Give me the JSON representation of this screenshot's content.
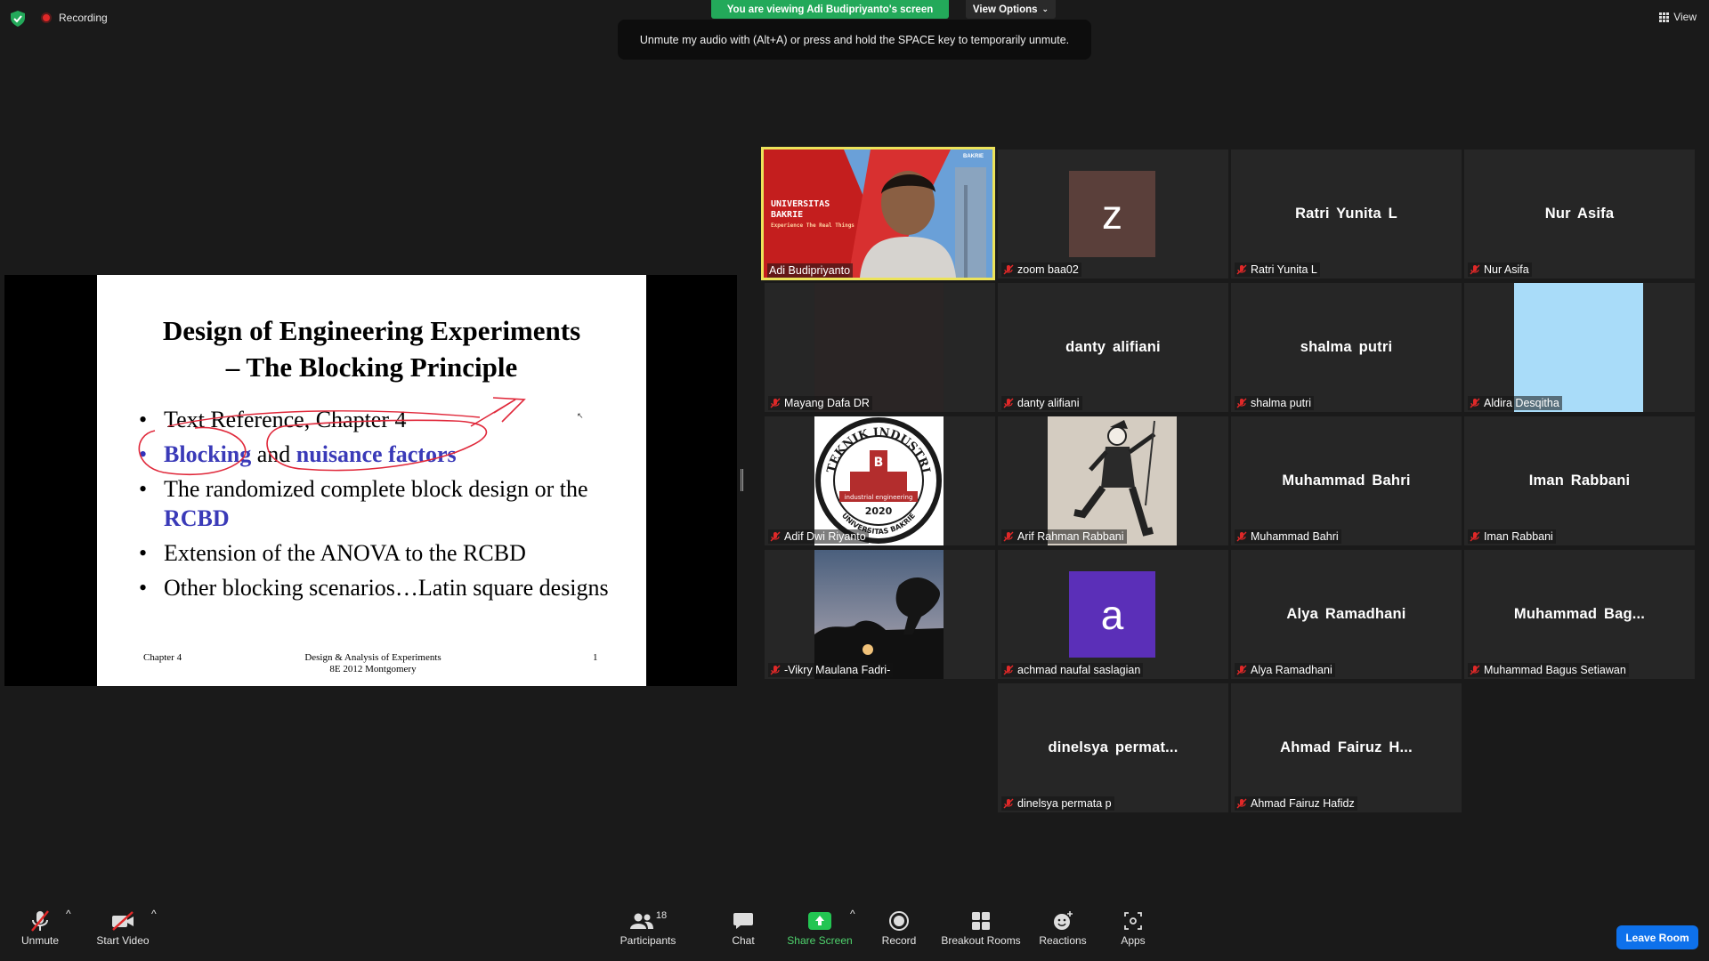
{
  "top": {
    "recording": "Recording",
    "viewing_banner": "You are viewing Adi Budipriyanto's screen",
    "view_options": "View Options",
    "tooltip": "Unmute my audio with (Alt+A) or press and hold the SPACE key to temporarily unmute.",
    "view": "View"
  },
  "slide": {
    "title_line1": "Design of Engineering Experiments",
    "title_line2": "– The Blocking Principle",
    "bullets": [
      {
        "text": "Text Reference, Chapter 4"
      },
      {
        "pre": "Blocking",
        "mid": " and ",
        "post": "nuisance factors"
      },
      {
        "text": "The randomized complete block design or the ",
        "hl": "RCBD"
      },
      {
        "text": "Extension of the ANOVA to the RCBD"
      },
      {
        "text": "Other blocking scenarios…Latin square designs"
      }
    ],
    "footer_left": "Chapter 4",
    "footer_center_1": "Design & Analysis of Experiments",
    "footer_center_2": "8E 2012 Montgomery",
    "footer_right": "1"
  },
  "speaker": {
    "name": "Adi Budipriyanto",
    "banner_1": "UNIVERSITAS",
    "banner_2": "BAKRIE",
    "tagline": "Experience The Real Things",
    "logo": "BAKRIE"
  },
  "participants": [
    {
      "label": "zoom baa02",
      "avatar": "z",
      "avatar_color": "#5a3f3a"
    },
    {
      "label": "Ratri Yunita L",
      "name": "Ratri Yunita L"
    },
    {
      "label": "Nur Asifa",
      "name": "Nur Asifa"
    },
    {
      "label": "Mayang Dafa DR"
    },
    {
      "label": "danty alifiani",
      "name": "danty alifiani"
    },
    {
      "label": "shalma putri",
      "name": "shalma putri"
    },
    {
      "label": "Aldira Desqitha",
      "color": "#a9dcf9"
    },
    {
      "label": "Adif Dwi Riyanto",
      "logo_top": "TEKNIK INDUSTRI",
      "logo_mid": "industrial engineering",
      "logo_year": "2020",
      "logo_bottom": "UNIVERSITAS BAKRIE"
    },
    {
      "label": "Arif Rahman Rabbani"
    },
    {
      "label": "Muhammad Bahri",
      "name": "Muhammad Bahri"
    },
    {
      "label": "Iman Rabbani",
      "name": "Iman Rabbani"
    },
    {
      "label": "-Vikry Maulana Fadri-"
    },
    {
      "label": "achmad naufal saslagian",
      "avatar": "a",
      "avatar_color": "#5b2fb8"
    },
    {
      "label": "Alya Ramadhani",
      "name": "Alya Ramadhani"
    },
    {
      "label": "Muhammad Bagus Setiawan",
      "name": "Muhammad  Bag..."
    },
    {
      "label": "dinelsya permata p",
      "name": "dinelsya  permat..."
    },
    {
      "label": "Ahmad Fairuz Hafidz",
      "name": "Ahmad  Fairuz  H..."
    }
  ],
  "toolbar": {
    "unmute": "Unmute",
    "start_video": "Start Video",
    "participants": "Participants",
    "participants_count": "18",
    "chat": "Chat",
    "share_screen": "Share Screen",
    "record": "Record",
    "breakout": "Breakout Rooms",
    "reactions": "Reactions",
    "apps": "Apps",
    "leave": "Leave Room"
  },
  "colors": {
    "share_green": "#23a95a",
    "leave_blue": "#0e71eb",
    "speaker_border": "#ece35a",
    "muted_red": "#e02828"
  }
}
